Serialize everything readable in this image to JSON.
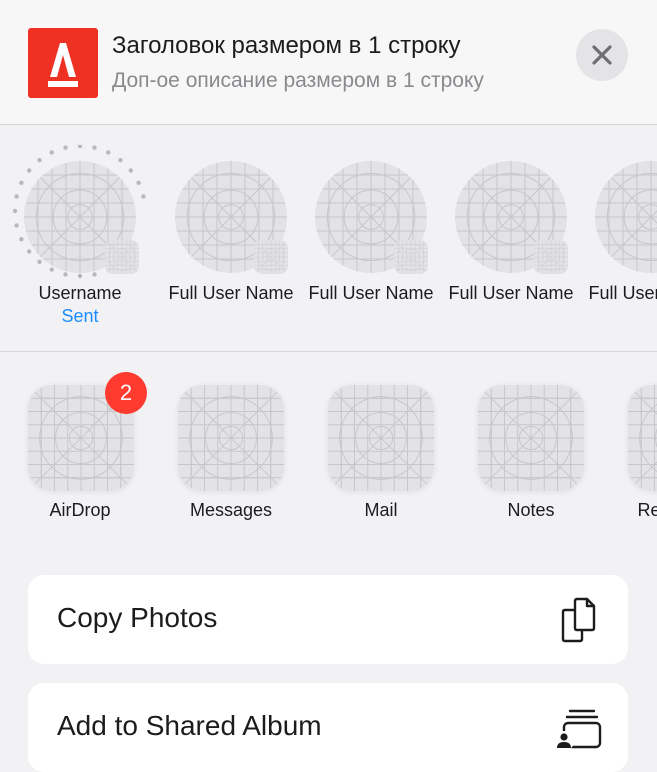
{
  "header": {
    "title": "Заголовок размером в 1 строку",
    "subtitle": "Доп-ое описание размером в 1 строку",
    "logo_letter": "А",
    "brand_color": "#ef3124",
    "close_icon": "close-icon"
  },
  "people": [
    {
      "name": "Username",
      "status": "Sent",
      "sending": true
    },
    {
      "name": "Full User Name",
      "status": ""
    },
    {
      "name": "Full User Name",
      "status": ""
    },
    {
      "name": "Full User Name",
      "status": ""
    },
    {
      "name": "Full User Name",
      "status": ""
    }
  ],
  "apps": [
    {
      "label": "AirDrop",
      "badge": "2"
    },
    {
      "label": "Messages"
    },
    {
      "label": "Mail"
    },
    {
      "label": "Notes"
    },
    {
      "label": "Reminders"
    }
  ],
  "actions": [
    {
      "label": "Copy Photos",
      "icon": "copy-icon"
    },
    {
      "label": "Add to Shared Album",
      "icon": "shared-album-icon"
    }
  ],
  "colors": {
    "accent": "#1a8cff",
    "badge": "#ff3b30",
    "background": "#f2f2f4"
  }
}
